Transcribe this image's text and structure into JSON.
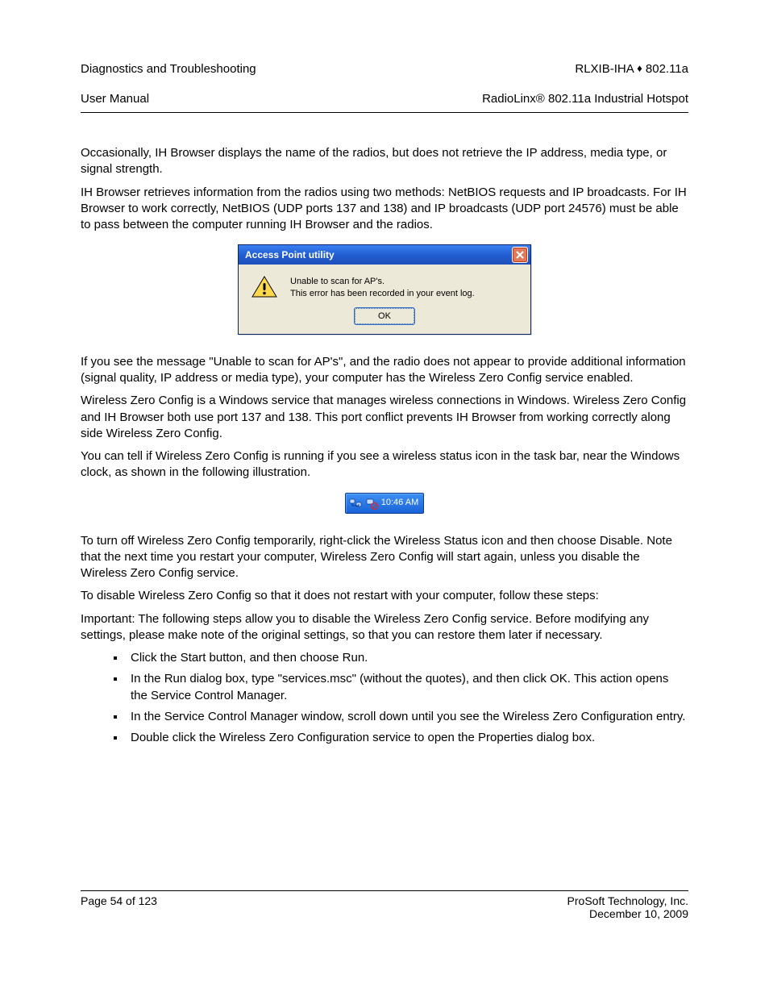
{
  "header": {
    "left_line1": "Diagnostics and Troubleshooting",
    "left_line2": "User Manual",
    "right_line1_a": "RLXIB-IHA ",
    "right_line1_b": " 802.11a",
    "right_line2": "RadioLinx® 802.11a Industrial Hotspot"
  },
  "para1": "Occasionally, IH Browser displays the name of the radios, but does not retrieve the IP address, media type, or signal strength.",
  "para2": "IH Browser retrieves information from the radios using two methods: NetBIOS requests and IP broadcasts. For IH Browser to work correctly, NetBIOS (UDP ports 137 and 138) and IP broadcasts (UDP port 24576) must be able to pass between the computer running IH Browser and the radios.",
  "dialog": {
    "title": "Access Point utility",
    "msg_line1": "Unable to scan for AP's.",
    "msg_line2": "This error has been recorded in your event log.",
    "ok_label": "OK"
  },
  "para3": "If you see the message \"Unable to scan for AP's\", and the radio does not appear to provide additional information (signal quality, IP address or media type), your computer has the Wireless Zero Config service enabled.",
  "para4": "Wireless Zero Config is a Windows service that manages wireless connections in Windows. Wireless Zero Config and IH Browser both use port 137 and 138. This port conflict prevents IH Browser from working correctly along side Wireless Zero Config.",
  "para5": "You can tell if Wireless Zero Config is running if you see a wireless status icon in the task bar, near the Windows clock, as shown in the following illustration.",
  "tray": {
    "time": "10:46 AM"
  },
  "para6": "To turn off Wireless Zero Config temporarily, right-click the Wireless Status icon and then choose Disable. Note that the next time you restart your computer, Wireless Zero Config will start again, unless you disable the Wireless Zero Config service.",
  "para7": "To disable Wireless Zero Config so that it does not restart with your computer, follow these steps:",
  "para8": "Important: The following steps allow you to disable the Wireless Zero Config service. Before modifying any settings, please make note of the original settings, so that you can restore them later if necessary.",
  "bullets": [
    "Click the Start button, and then choose Run.",
    "In the Run dialog box, type \"services.msc\" (without the quotes), and then click OK. This action opens the Service Control Manager.",
    "In the Service Control Manager window, scroll down until you see the Wireless Zero Configuration entry.",
    "Double click the Wireless Zero Configuration service to open the Properties dialog box."
  ],
  "footer": {
    "left": "Page 54 of 123",
    "right_line1": "ProSoft Technology, Inc.",
    "right_line2": "December 10, 2009"
  }
}
